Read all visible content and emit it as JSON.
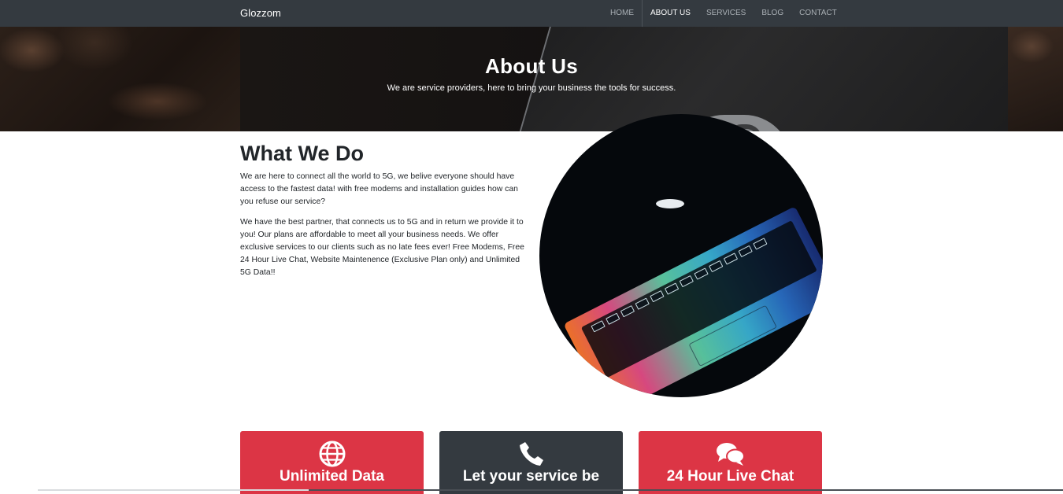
{
  "navbar": {
    "brand": "Glozzom",
    "links": [
      {
        "label": "HOME"
      },
      {
        "label": "ABOUT US",
        "active": true
      },
      {
        "label": "SERVICES"
      },
      {
        "label": "BLOG"
      },
      {
        "label": "CONTACT"
      }
    ]
  },
  "hero": {
    "title": "About Us",
    "subtitle": "We are service providers, here to bring your business the tools for success."
  },
  "about": {
    "title": "What We Do",
    "paragraphs": [
      "We are here to connect all the world to 5G, we belive everyone should have access to the fastest data! with free modems and installation guides how can you refuse our service?",
      "We have the best partner, that connects us to 5G and in return we provide it to you! Our plans are affordable to meet all your business needs. We offer exclusive services to our clients such as no late fees ever! Free Modems, Free 24 Hour Live Chat, Website Maintenence (Exclusive Plan only) and Unlimited 5G Data!!"
    ],
    "image_icon": "laptop-keyboard-image"
  },
  "cards": [
    {
      "icon": "globe-icon",
      "title": "Unlimited Data",
      "color": "#dc3545"
    },
    {
      "icon": "phone-icon",
      "title": "Let your service be",
      "color": "#343a40"
    },
    {
      "icon": "chat-icon",
      "title": "24 Hour Live Chat",
      "color": "#dc3545"
    }
  ],
  "colors": {
    "navbar": "#343a40",
    "accent_red": "#dc3545",
    "dark_card": "#343a40"
  }
}
